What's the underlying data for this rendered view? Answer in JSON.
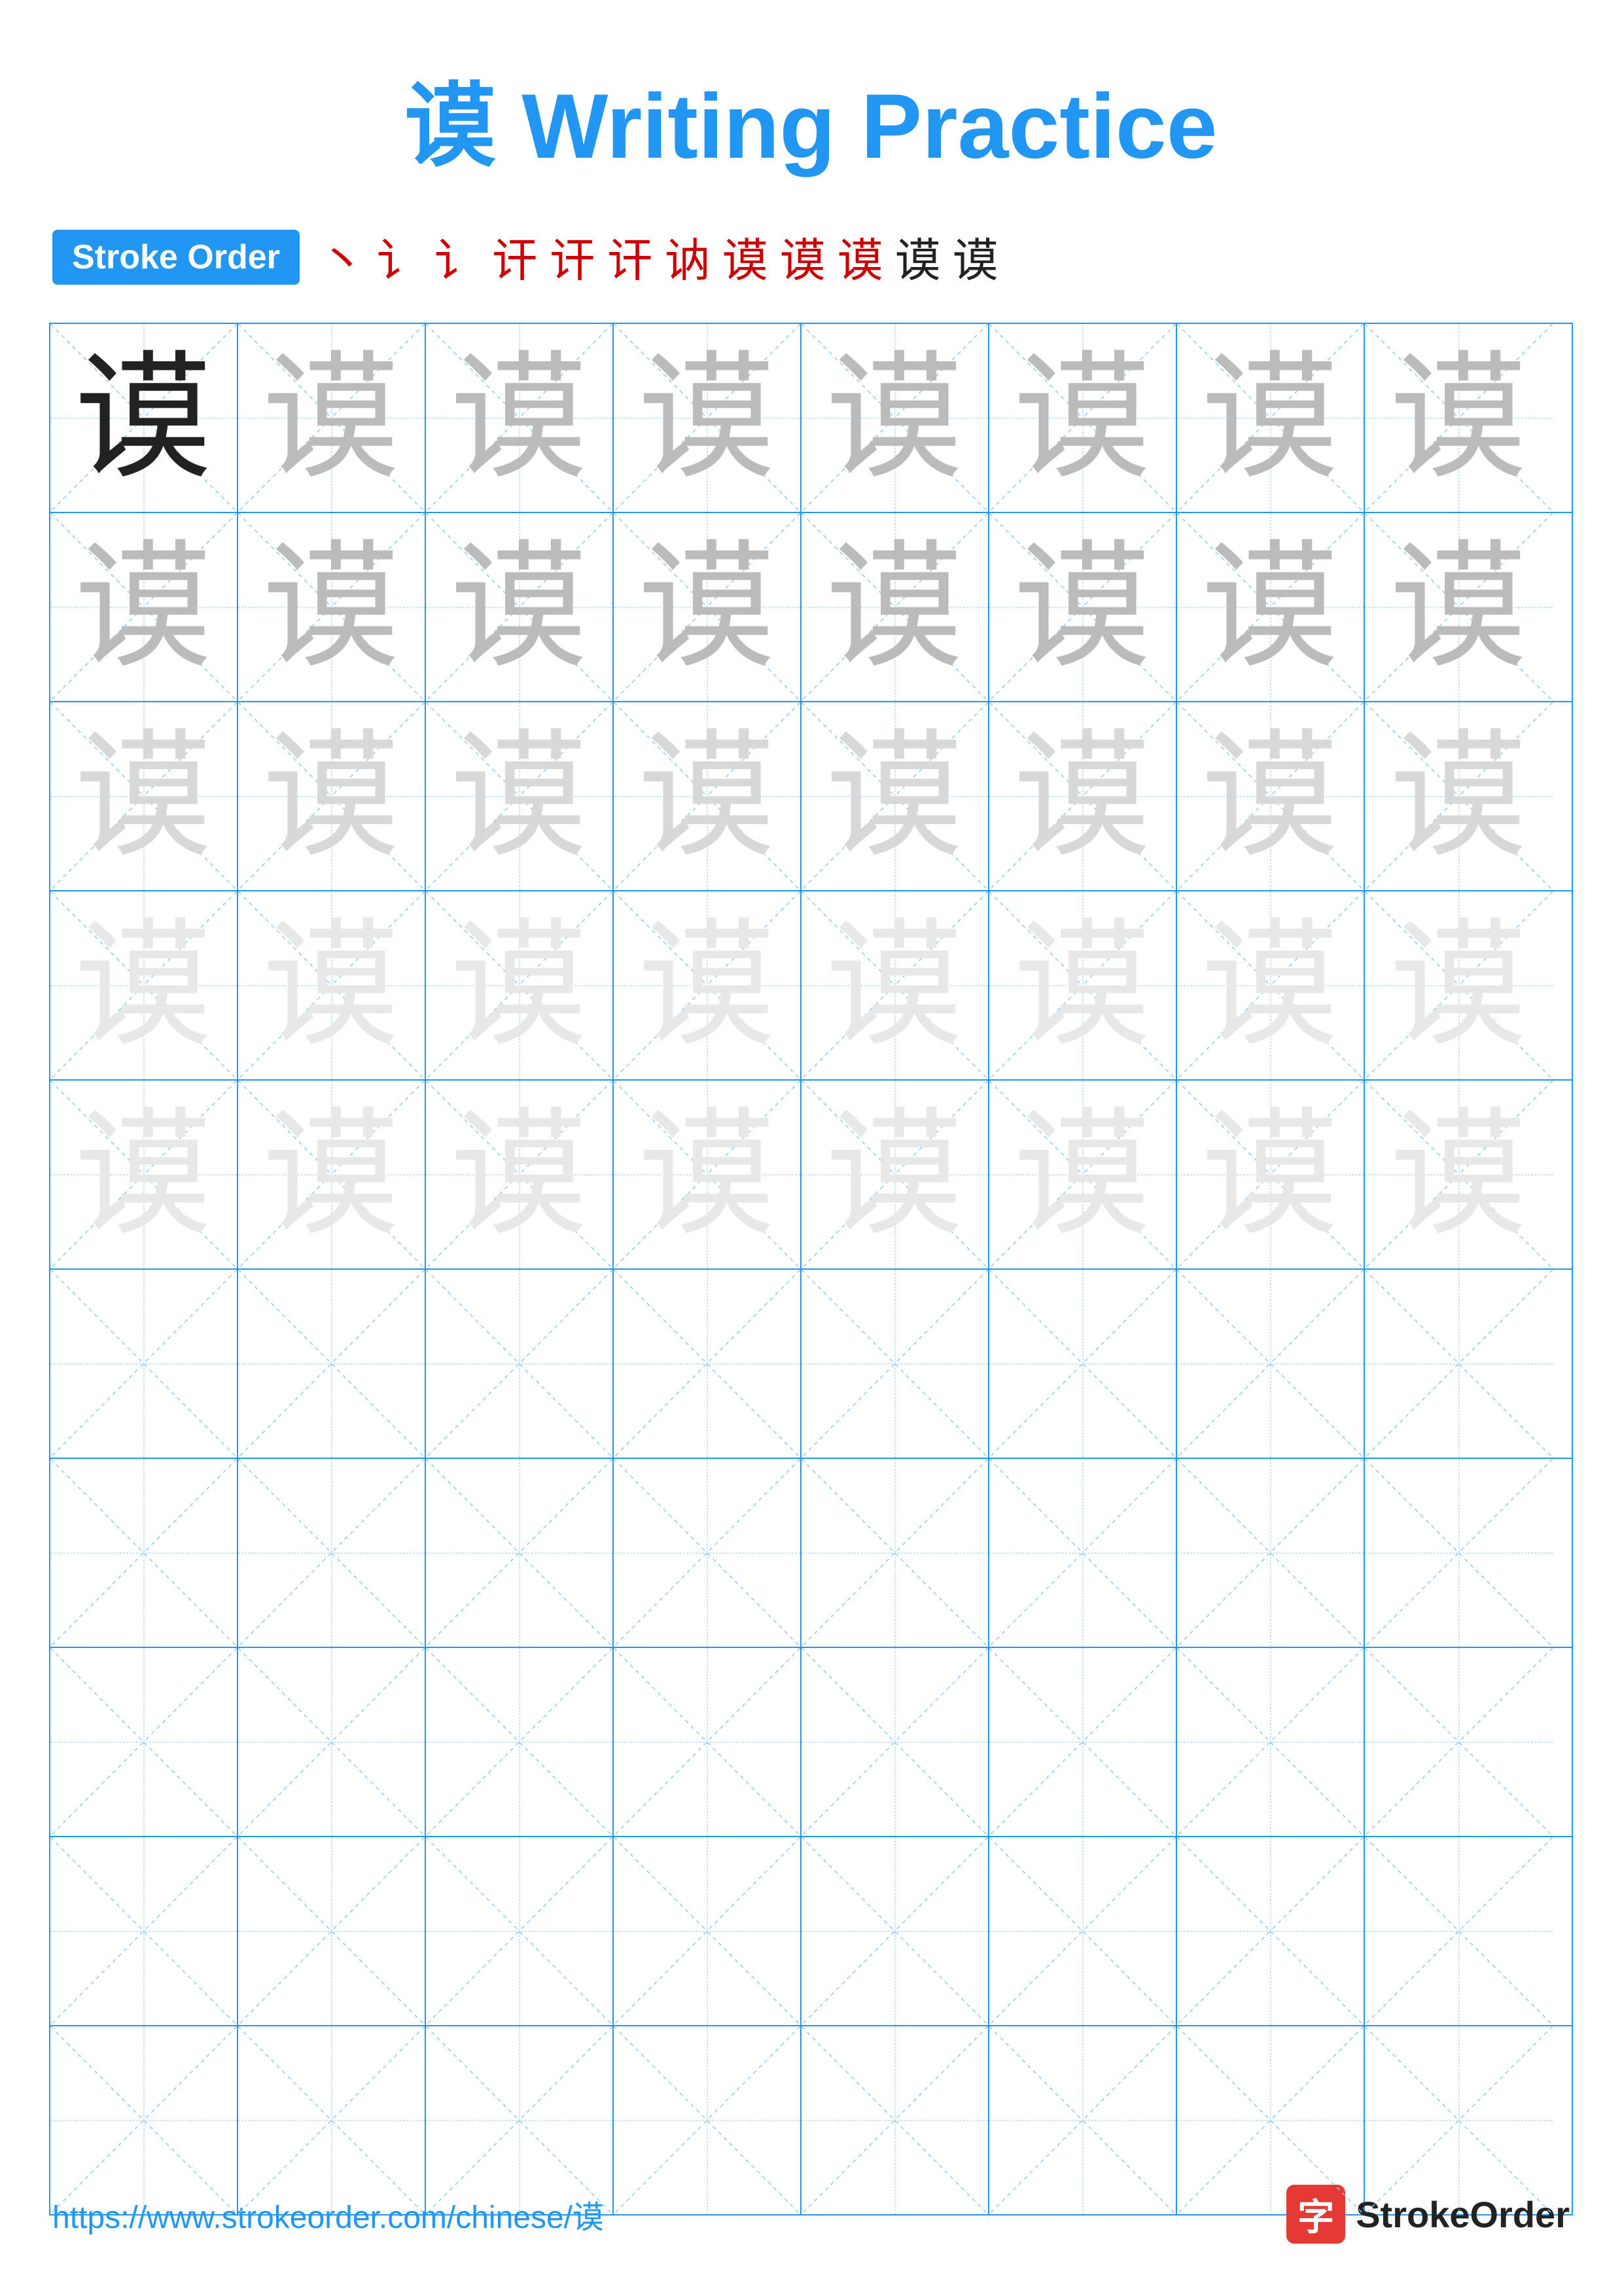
{
  "title": {
    "char": "谟",
    "text": " Writing Practice"
  },
  "stroke_order": {
    "badge_label": "Stroke Order",
    "strokes": [
      "丶",
      "讠",
      "讠",
      "讦",
      "讦",
      "讦",
      "讷",
      "谟",
      "谟",
      "谟",
      "谟",
      "谟"
    ]
  },
  "grid": {
    "rows": 10,
    "cols": 8,
    "char": "谟",
    "row_styles": [
      "dark",
      "medium",
      "medium",
      "light",
      "very-light",
      "empty",
      "empty",
      "empty",
      "empty",
      "empty"
    ]
  },
  "footer": {
    "url": "https://www.strokeorder.com/chinese/谟",
    "brand_icon": "字",
    "brand_name": "StrokeOrder"
  }
}
